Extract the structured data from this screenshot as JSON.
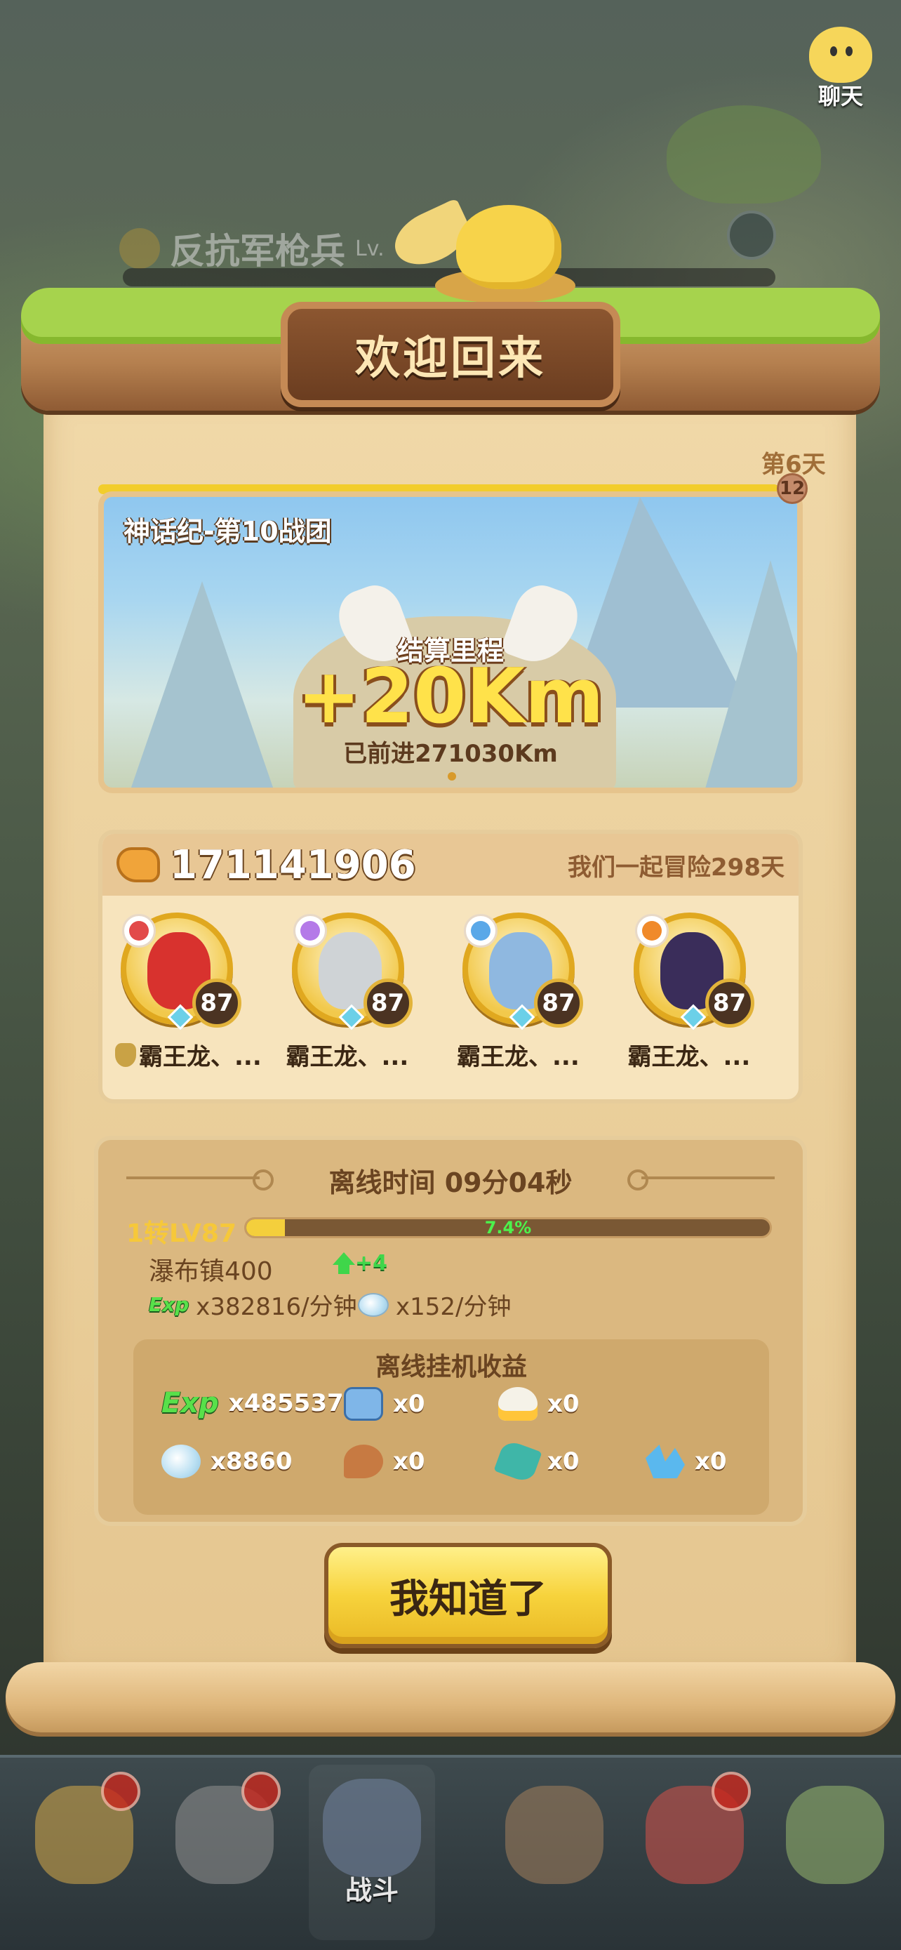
{
  "chat": {
    "label": "聊天"
  },
  "background": {
    "unit_name": "反抗军枪兵",
    "unit_level": "Lv."
  },
  "dialog": {
    "title": "欢迎回来",
    "day_label": "第6天",
    "day_badge": "12"
  },
  "banner": {
    "stage_name": "神话纪-第10战团",
    "settlement_label": "结算里程",
    "gained": "+20Km",
    "total": "已前进271030Km"
  },
  "team": {
    "power": "171141906",
    "adventure_days": "我们一起冒险298天",
    "heroes": [
      {
        "name": "霸王龙、...",
        "level": "87",
        "element_color": "#e24a4a",
        "hair_color": "#d8322e",
        "leader": true
      },
      {
        "name": "霸王龙、...",
        "level": "87",
        "element_color": "#b47ae8",
        "hair_color": "#cfd3d6",
        "leader": false
      },
      {
        "name": "霸王龙、...",
        "level": "87",
        "element_color": "#5aa8e8",
        "hair_color": "#8fb8e0",
        "leader": false
      },
      {
        "name": "霸王龙、...",
        "level": "87",
        "element_color": "#f08a2a",
        "hair_color": "#3a2d5a",
        "leader": false
      }
    ]
  },
  "offline": {
    "title": "离线时间 09分04秒",
    "level_label": "1转LV87",
    "exp_percent": 7.4,
    "exp_percent_label": "7.4%",
    "location": "瀑布镇400",
    "location_gain": "+4",
    "exp_tag": "Exp",
    "exp_rate": "x382816/分钟",
    "stone_rate": "x152/分钟",
    "earnings_title": "离线挂机收益",
    "rewards": [
      {
        "icon": "exp-icon",
        "value": "x4855376"
      },
      {
        "icon": "ticket-icon",
        "value": "x0"
      },
      {
        "icon": "flame-icon",
        "value": "x0"
      },
      {
        "icon": "stone-icon",
        "value": "x8860"
      },
      {
        "icon": "meat-icon",
        "value": "x0"
      },
      {
        "icon": "teal-gem-icon",
        "value": "x0"
      },
      {
        "icon": "crystal-icon",
        "value": "x0"
      }
    ]
  },
  "confirm_button": "我知道了",
  "bottom_nav": {
    "battle_label": "战斗"
  }
}
